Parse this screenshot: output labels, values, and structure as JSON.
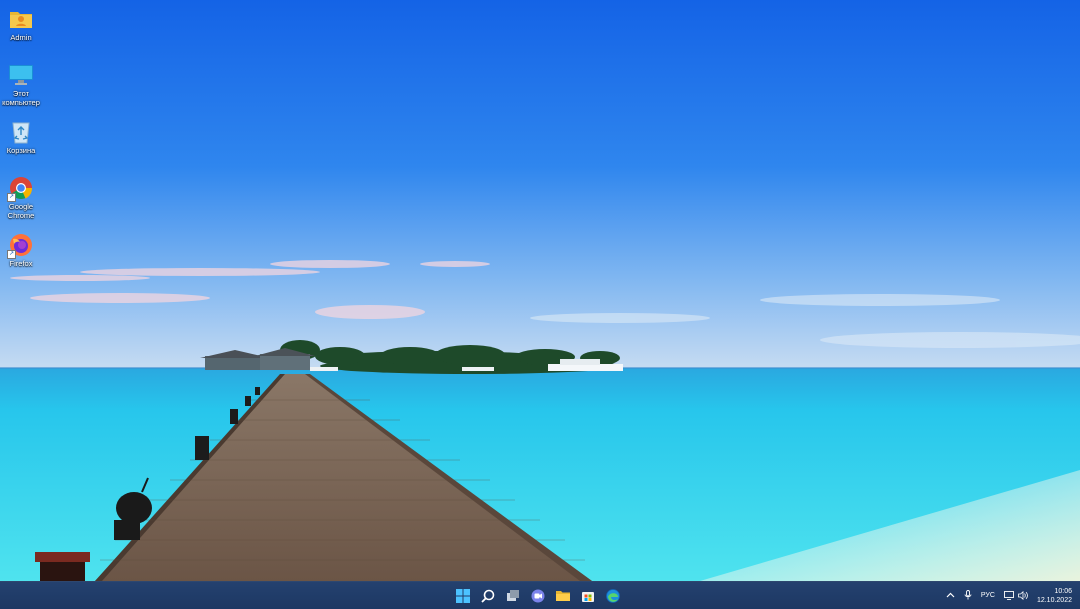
{
  "desktop": {
    "icons": [
      {
        "label": "Admin",
        "icon": "user-folder-icon"
      },
      {
        "label": "Этот компьютер",
        "icon": "monitor-icon"
      },
      {
        "label": "Корзина",
        "icon": "recycle-bin-icon"
      },
      {
        "label": "Google Chrome",
        "icon": "chrome-icon"
      },
      {
        "label": "Firefox",
        "icon": "firefox-icon"
      }
    ]
  },
  "taskbar": {
    "apps": [
      "start-icon",
      "search-icon",
      "task-view-icon",
      "chat-icon",
      "file-explorer-icon",
      "store-icon",
      "edge-icon"
    ],
    "tray": {
      "language": "РУС",
      "time": "10:06",
      "date": "12.10.2022"
    }
  },
  "colors": {
    "sky_top": "#1766e8",
    "sea": "#2ad0ec",
    "taskbar": "#1f3a66"
  }
}
